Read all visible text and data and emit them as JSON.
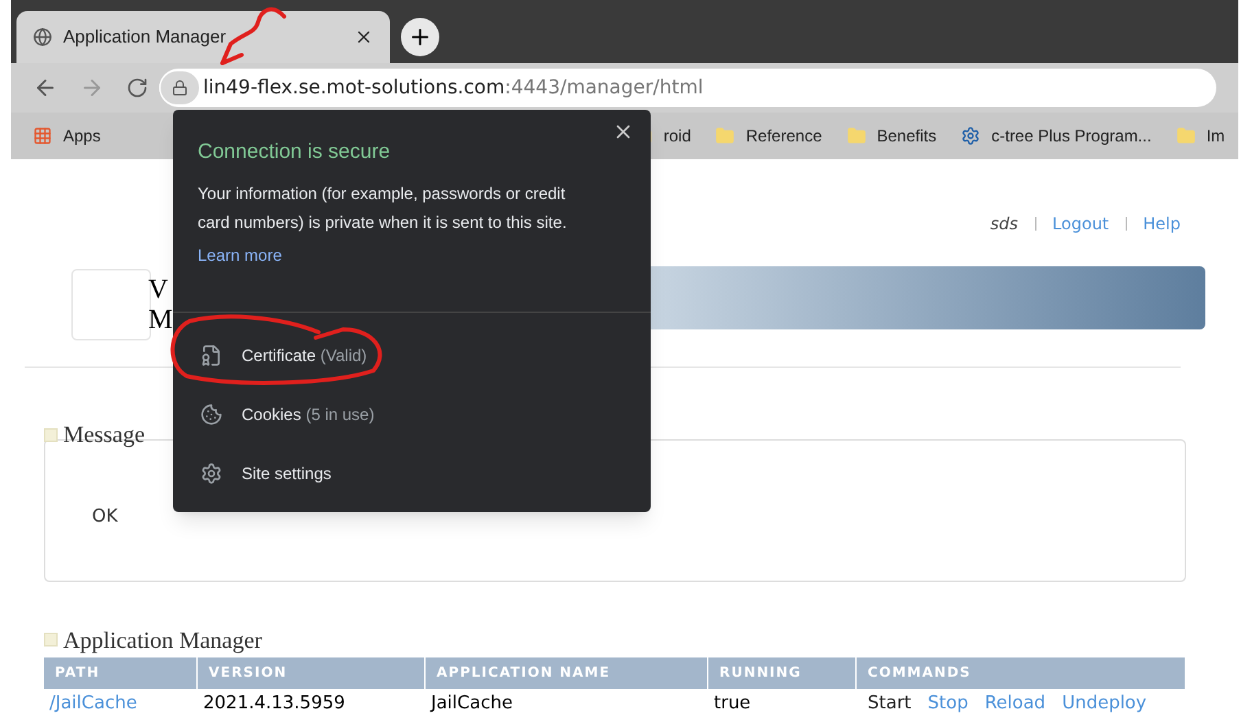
{
  "browser": {
    "tab": {
      "title": "Application Manager"
    },
    "address": {
      "host": "lin49-flex.se.mot-solutions.com",
      "rest": ":4443/manager/html"
    },
    "bookmarks": [
      {
        "kind": "apps",
        "label": "Apps"
      },
      {
        "kind": "folder",
        "label": "roid"
      },
      {
        "kind": "folder",
        "label": "Reference"
      },
      {
        "kind": "folder",
        "label": "Benefits"
      },
      {
        "kind": "gear",
        "label": "c-tree Plus Program..."
      },
      {
        "kind": "folder",
        "label": "Im"
      }
    ]
  },
  "popup": {
    "title": "Connection is secure",
    "text": "Your information (for example, passwords or credit card numbers) is private when it is sent to this site.",
    "link": "Learn more",
    "items": [
      {
        "kind": "certificate",
        "label": "Certificate",
        "detail": "(Valid)"
      },
      {
        "kind": "cookies",
        "label": "Cookies",
        "detail": "(5 in use)"
      },
      {
        "kind": "settings",
        "label": "Site settings"
      }
    ]
  },
  "header": {
    "user": "sds",
    "links": [
      "Logout",
      "Help"
    ],
    "title_lines": [
      "V",
      "M"
    ]
  },
  "message": {
    "title": "Message",
    "text": "OK"
  },
  "manager": {
    "title": "Application Manager",
    "columns": [
      "PATH",
      "VERSION",
      "APPLICATION NAME",
      "RUNNING",
      "COMMANDS"
    ],
    "rows": [
      {
        "path": "/JailCache",
        "version": "2021.4.13.5959",
        "name": "JailCache",
        "running": "true",
        "commands": [
          {
            "label": "Start",
            "enabled": false
          },
          {
            "label": "Stop",
            "enabled": true
          },
          {
            "label": "Reload",
            "enabled": true
          },
          {
            "label": "Undeploy",
            "enabled": true
          }
        ]
      }
    ]
  }
}
